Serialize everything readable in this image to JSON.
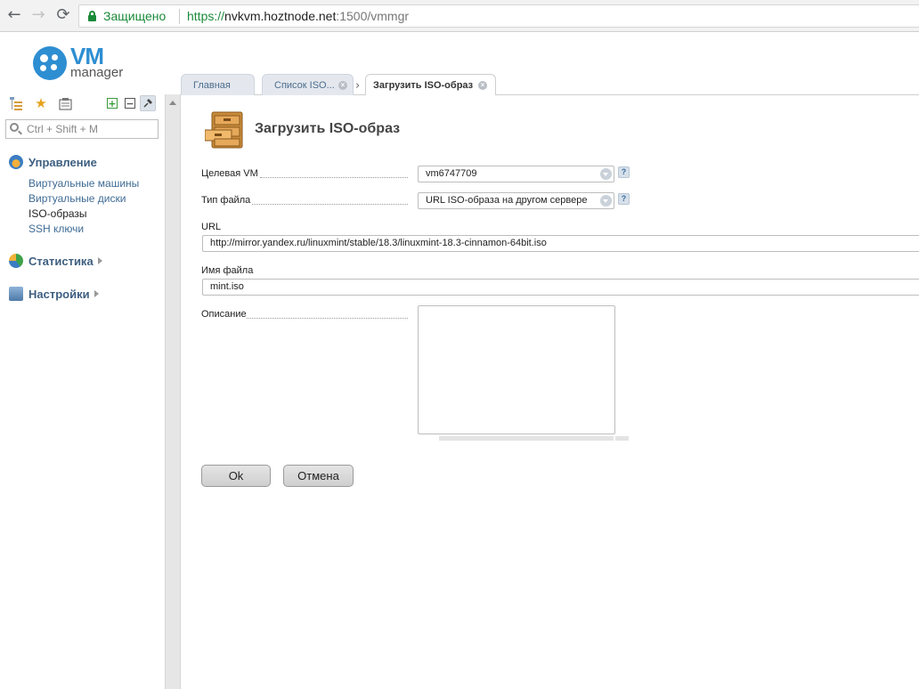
{
  "browser": {
    "back": "←",
    "forward": "→",
    "reload": "⟳",
    "secure_label": "Защищено",
    "url_scheme": "https://",
    "url_host": "nvkvm.hoztnode.net",
    "url_path": ":1500/vmmgr"
  },
  "logo": {
    "vm": "VM",
    "manager": "manager"
  },
  "sidebar": {
    "search_placeholder": "Ctrl + Shift + M",
    "groups": [
      {
        "label": "Управление",
        "items": [
          "Виртуальные машины",
          "Виртуальные диски",
          "ISO-образы",
          "SSH ключи"
        ],
        "active_item": "ISO-образы"
      },
      {
        "label": "Статистика"
      },
      {
        "label": "Настройки"
      }
    ]
  },
  "tabs": [
    {
      "label": "Главная"
    },
    {
      "label": "Список ISO..."
    },
    {
      "label": "Загрузить ISO-образ",
      "active": true
    }
  ],
  "form": {
    "title": "Загрузить ISO-образ",
    "fields": {
      "target_vm": {
        "label": "Целевая VM",
        "value": "vm6747709"
      },
      "file_type": {
        "label": "Тип файла",
        "value": "URL ISO-образа на другом сервере"
      },
      "url": {
        "label": "URL",
        "value": "http://mirror.yandex.ru/linuxmint/stable/18.3/linuxmint-18.3-cinnamon-64bit.iso"
      },
      "file_name": {
        "label": "Имя файла",
        "value": "mint.iso"
      },
      "description": {
        "label": "Описание",
        "value": ""
      }
    },
    "help": "?",
    "ok_label": "Ok",
    "cancel_label": "Отмена"
  },
  "colors": {
    "accent": "#2e8ed2",
    "secure": "#1a8a3a",
    "link": "#3f6b94"
  }
}
